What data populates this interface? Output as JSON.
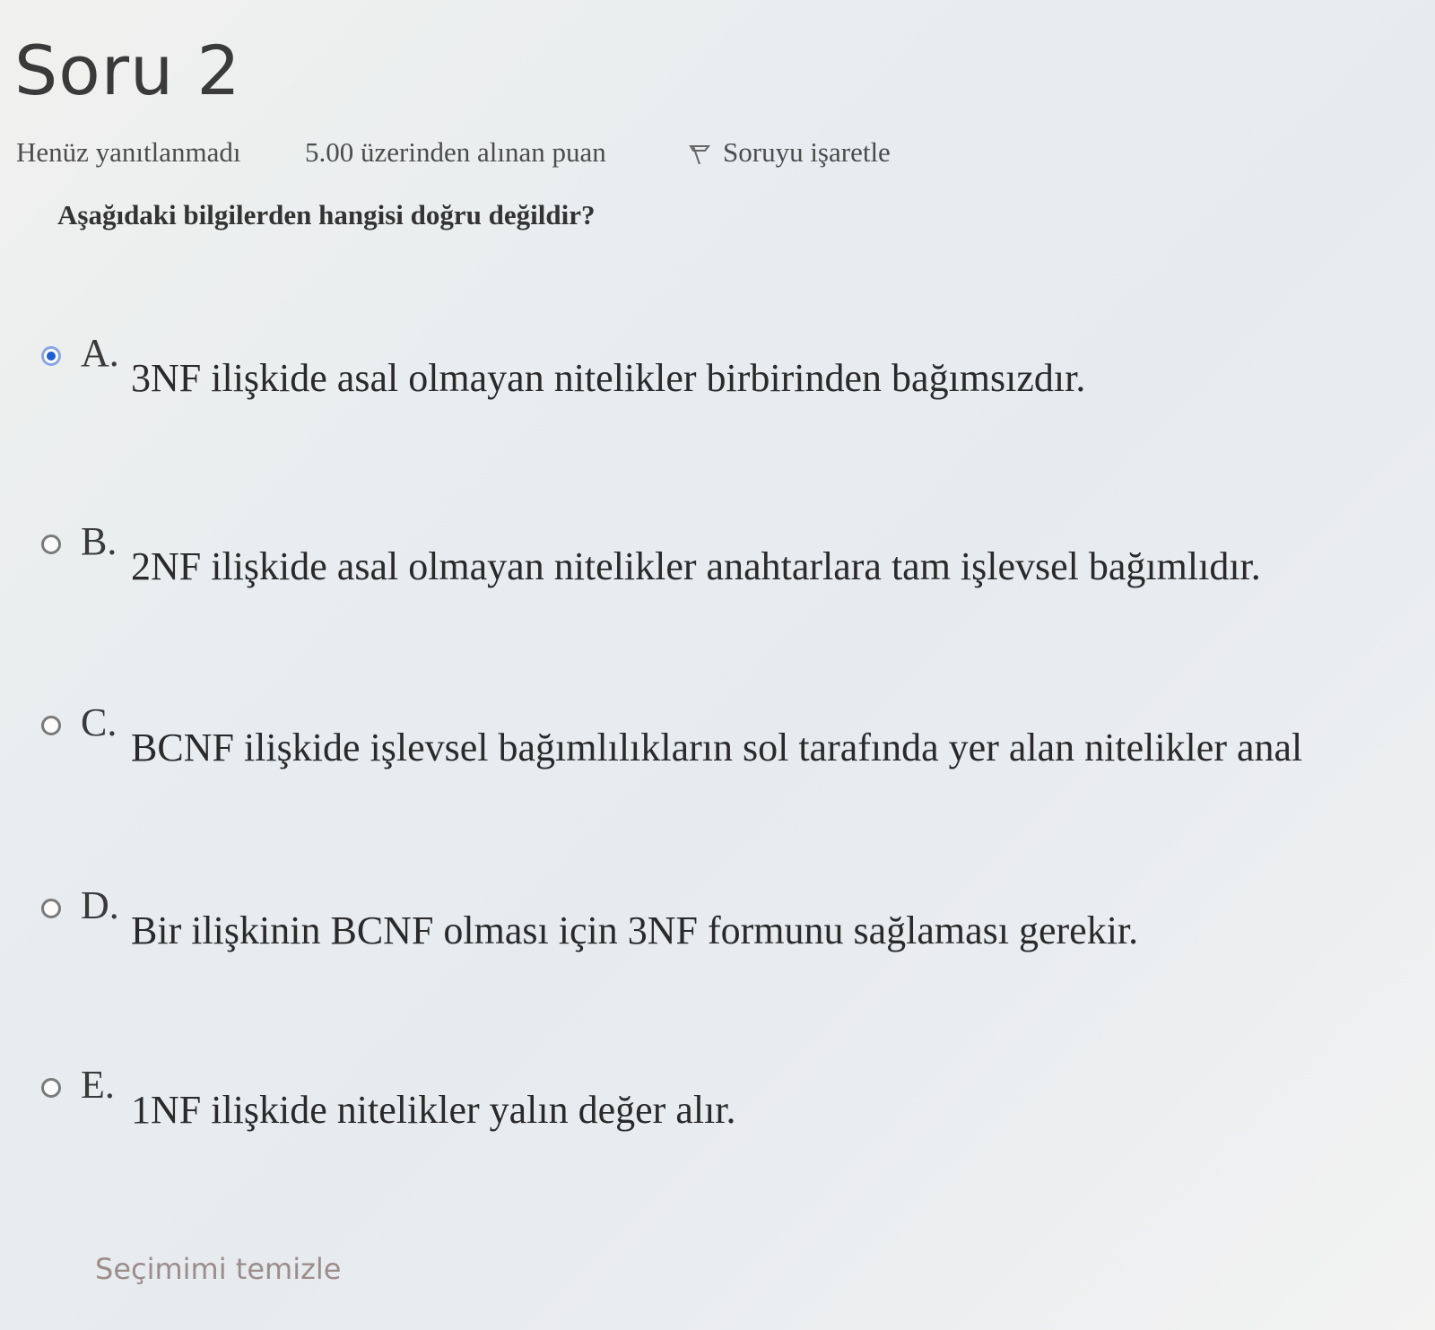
{
  "question_header": {
    "title": "Soru 2",
    "status": "Henüz yanıtlanmadı",
    "grade": "5.00 üzerinden alınan puan",
    "flag_label": "Soruyu işaretle",
    "flag_icon": "flag-icon"
  },
  "question": {
    "text": "Aşağıdaki bilgilerden hangisi doğru değildir?"
  },
  "options": [
    {
      "letter": "A.",
      "text": "3NF ilişkide asal olmayan nitelikler birbirinden bağımsızdır.",
      "selected": true
    },
    {
      "letter": "B.",
      "text": "2NF ilişkide asal olmayan nitelikler anahtarlara tam işlevsel bağımlıdır.",
      "selected": false
    },
    {
      "letter": "C.",
      "text": "BCNF ilişkide işlevsel bağımlılıkların sol tarafında yer alan nitelikler anal",
      "selected": false
    },
    {
      "letter": "D.",
      "text": "Bir ilişkinin BCNF olması için 3NF formunu sağlaması gerekir.",
      "selected": false
    },
    {
      "letter": "E.",
      "text": "1NF ilişkide nitelikler yalın değer alır.",
      "selected": false
    }
  ],
  "clear_choice": "Seçimimi temizle",
  "colors": {
    "selected_radio": "#1f5fd6",
    "clear_link": "#9a8e8c"
  }
}
